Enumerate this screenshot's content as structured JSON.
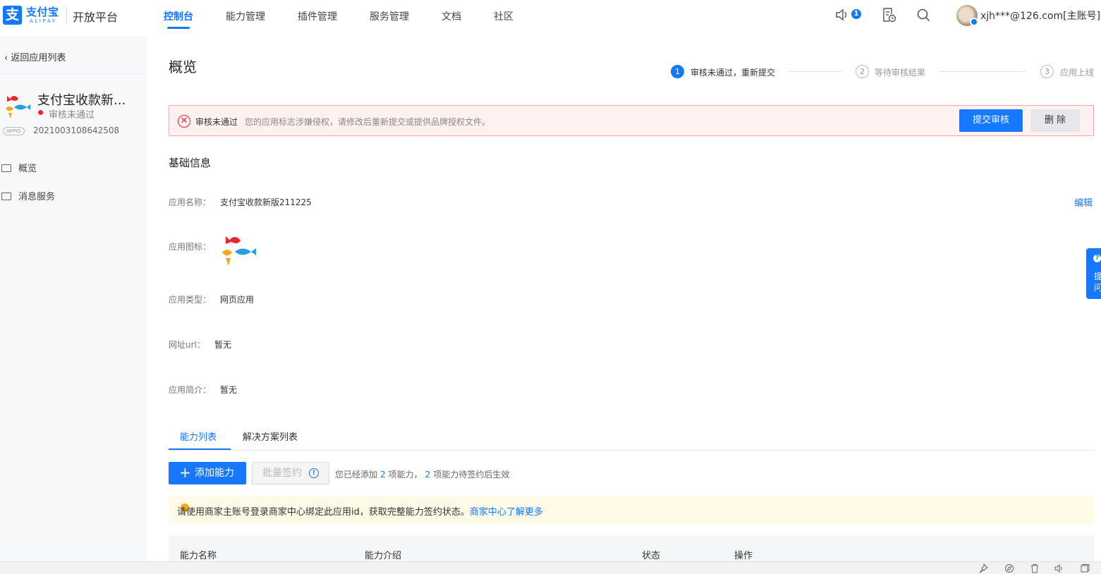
{
  "header": {
    "logo_cn": "支付宝",
    "logo_en": "ALIPAY",
    "logo_glyph": "支",
    "platform": "开放平台",
    "nav": [
      {
        "label": "控制台",
        "active": true
      },
      {
        "label": "能力管理"
      },
      {
        "label": "插件管理"
      },
      {
        "label": "服务管理"
      },
      {
        "label": "文档"
      },
      {
        "label": "社区"
      }
    ],
    "notification_count": "1",
    "account": "xjh***@126.com[主账号]"
  },
  "sidebar": {
    "back_label": "返回应用列表",
    "app_name": "支付宝收款新...",
    "status": "审核未通过",
    "appid_tag": "APPID",
    "appid": "2021003108642508",
    "menu": [
      {
        "label": "概览"
      },
      {
        "label": "消息服务"
      }
    ]
  },
  "main": {
    "title": "概览",
    "steps": [
      {
        "num": "1",
        "label": "审核未通过，重新提交",
        "state": "active"
      },
      {
        "num": "2",
        "label": "等待审核结果",
        "state": "wait"
      },
      {
        "num": "3",
        "label": "应用上线",
        "state": "wait"
      }
    ],
    "alert": {
      "icon": "✕",
      "title": "审核未通过",
      "message": "您的应用标志涉嫌侵权，请修改后重新提交或提供品牌授权文件。",
      "submit_label": "提交审核",
      "delete_label": "删 除"
    },
    "basic_info": {
      "title": "基础信息",
      "edit_label": "编辑",
      "name_label": "应用名称：",
      "name_value": "支付宝收款新版211225",
      "icon_label": "应用图标：",
      "type_label": "应用类型：",
      "type_value": "网页应用",
      "url_label": "网址url：",
      "url_value": "暂无",
      "intro_label": "应用简介：",
      "intro_value": "暂无"
    },
    "tabs": [
      {
        "label": "能力列表",
        "active": true
      },
      {
        "label": "解决方案列表"
      }
    ],
    "add_button": "添加能力",
    "add_icon": "+",
    "batch_button": "批量签约",
    "info_icon": "!",
    "added_text_1": "您已经添加",
    "added_count": "2",
    "added_text_2": "项能力，",
    "pending_count": "2",
    "added_text_3": "项能力待签约后生效",
    "notice_text": "请使用商家主账号登录商家中心绑定此应用id，获取完整能力签约状态。",
    "notice_link": "商家中心了解更多",
    "table_headers": [
      "能力名称",
      "能力介绍",
      "状态",
      "操作"
    ]
  },
  "float_help": {
    "icon": "?",
    "line1": "提",
    "line2": "问"
  },
  "colors": {
    "primary": "#1677ff",
    "error": "#f5222d",
    "alert_bg": "#fff1f0",
    "notice_bg": "#fffbe6"
  }
}
